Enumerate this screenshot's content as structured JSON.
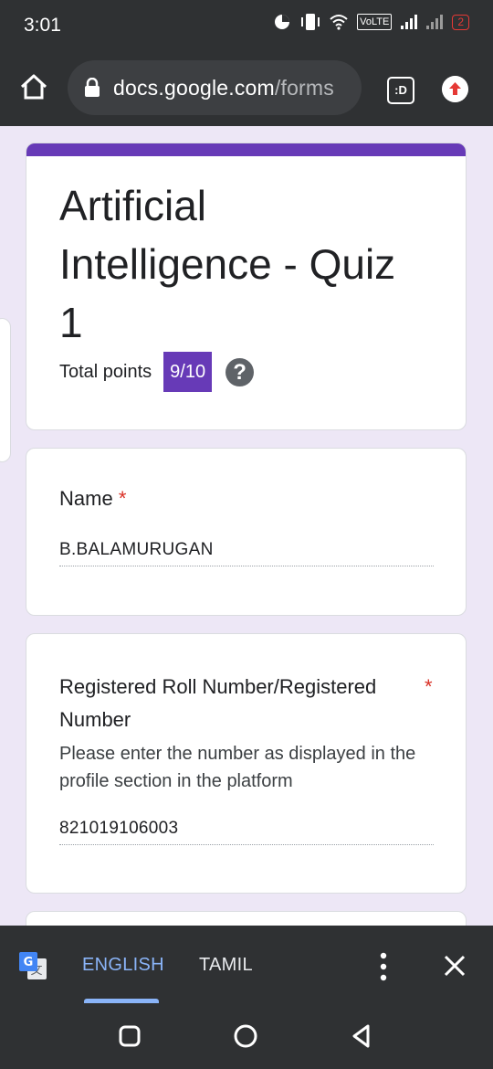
{
  "status_bar": {
    "time": "3:01",
    "volte": "VoLTE",
    "battery": "2",
    "icons": [
      "pie-clock-icon",
      "vibrate-icon",
      "wifi-icon",
      "signal-icon",
      "signal-icon",
      "battery-icon"
    ]
  },
  "browser": {
    "url_host": "docs.google.com",
    "url_path": "/forms",
    "tab_label": ":D",
    "icons": [
      "home-icon",
      "lock-icon",
      "tab-switcher-icon",
      "update-arrow-icon"
    ],
    "accent_color": "#e53935"
  },
  "form": {
    "accent_color": "#673ab7",
    "title": "Artificial Intelligence - Quiz 1",
    "points_label": "Total points",
    "points_value": "9/10",
    "help_glyph": "?",
    "questions": [
      {
        "label": "Name",
        "required_mark": "*",
        "answer": "B.BALAMURUGAN"
      },
      {
        "label": "Registered Roll Number/Registered Number",
        "required_mark": "*",
        "description": "Please enter the number as displayed in the profile section in the platform",
        "answer": "821019106003"
      }
    ]
  },
  "translate_bar": {
    "languages": [
      "ENGLISH",
      "TAMIL"
    ],
    "selected": "ENGLISH",
    "accent_color": "#8ab4f8",
    "icons": [
      "google-translate-icon",
      "more-vert-icon",
      "close-icon"
    ]
  },
  "nav_bar": {
    "icons": [
      "recents-icon",
      "home-circle-icon",
      "back-icon"
    ]
  }
}
